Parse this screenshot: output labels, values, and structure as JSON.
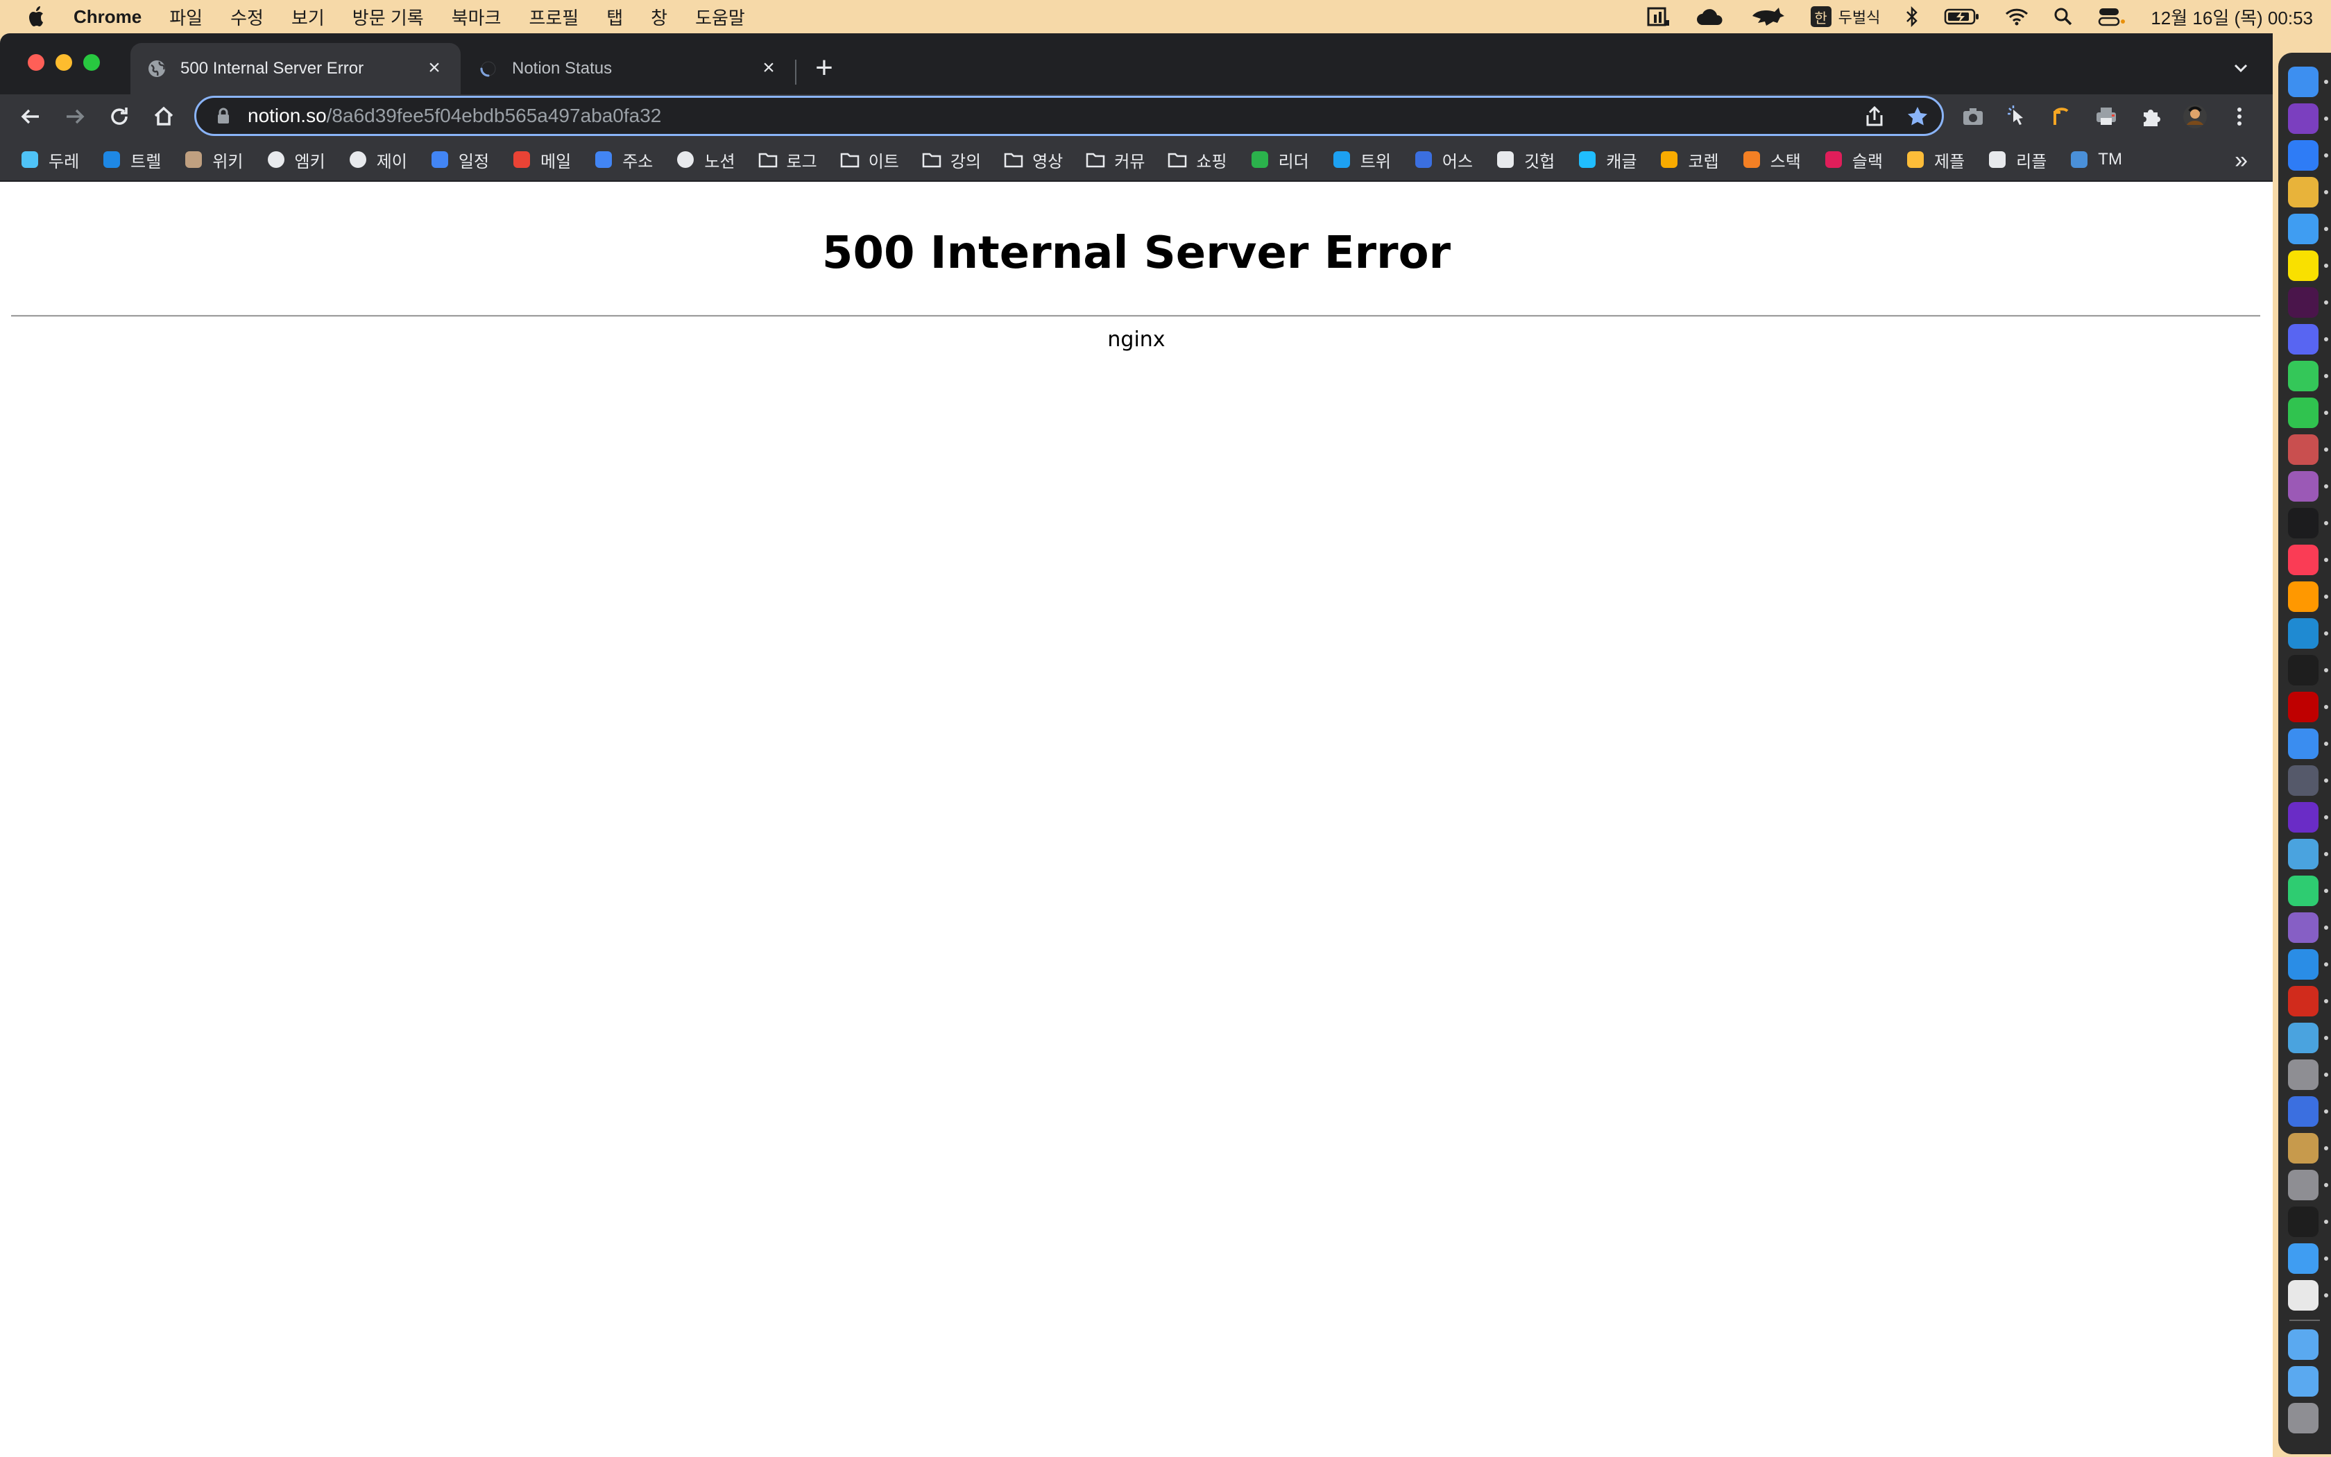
{
  "menubar": {
    "app_name": "Chrome",
    "items": [
      "파일",
      "수정",
      "보기",
      "방문 기록",
      "북마크",
      "프로필",
      "탭",
      "창",
      "도움말"
    ],
    "ime_label": "두벌식",
    "ime_char": "한",
    "clock": "12월 16일 (목) 00:53"
  },
  "tabs": [
    {
      "title": "500 Internal Server Error",
      "icon": "globe-icon",
      "active": true
    },
    {
      "title": "Notion Status",
      "icon": "loading-spinner-icon",
      "active": false
    }
  ],
  "omnibox": {
    "host": "notion.so",
    "path": "/8a6d39fee5f04ebdb565a497aba0fa32"
  },
  "bookmarks": [
    {
      "label": "두레",
      "icon": "mail-icon",
      "color": "#4fc3f7"
    },
    {
      "label": "트렐",
      "icon": "trello-icon",
      "color": "#1e88e5"
    },
    {
      "label": "위키",
      "icon": "wiki-icon",
      "color": "#c0a080"
    },
    {
      "label": "엠키",
      "icon": "globe-icon",
      "color": "#e8eaed"
    },
    {
      "label": "제이",
      "icon": "globe-icon",
      "color": "#e8eaed"
    },
    {
      "label": "일정",
      "icon": "calendar-icon",
      "color": "#4285f4"
    },
    {
      "label": "메일",
      "icon": "gmail-icon",
      "color": "#ea4335"
    },
    {
      "label": "주소",
      "icon": "contacts-icon",
      "color": "#4285f4"
    },
    {
      "label": "노션",
      "icon": "globe-icon",
      "color": "#e8eaed"
    },
    {
      "label": "로그",
      "icon": "folder-icon",
      "color": "#e8eaed"
    },
    {
      "label": "이트",
      "icon": "folder-icon",
      "color": "#e8eaed"
    },
    {
      "label": "강의",
      "icon": "folder-icon",
      "color": "#e8eaed"
    },
    {
      "label": "영상",
      "icon": "folder-icon",
      "color": "#e8eaed"
    },
    {
      "label": "커뮤",
      "icon": "folder-icon",
      "color": "#e8eaed"
    },
    {
      "label": "쇼핑",
      "icon": "folder-icon",
      "color": "#e8eaed"
    },
    {
      "label": "리더",
      "icon": "feedly-icon",
      "color": "#2bb24c"
    },
    {
      "label": "트위",
      "icon": "twitter-icon",
      "color": "#1da1f2"
    },
    {
      "label": "어스",
      "icon": "earth-icon",
      "color": "#3b6fe0"
    },
    {
      "label": "깃헙",
      "icon": "github-icon",
      "color": "#e8eaed"
    },
    {
      "label": "캐글",
      "icon": "kaggle-icon",
      "color": "#20beff"
    },
    {
      "label": "코렙",
      "icon": "colab-icon",
      "color": "#f9ab00"
    },
    {
      "label": "스택",
      "icon": "stackoverflow-icon",
      "color": "#f48024"
    },
    {
      "label": "슬랙",
      "icon": "slack-icon",
      "color": "#e01e5a"
    },
    {
      "label": "제플",
      "icon": "zeplin-icon",
      "color": "#fdbd39"
    },
    {
      "label": "리플",
      "icon": "replit-icon",
      "color": "#e8eaed"
    },
    {
      "label": "TM",
      "icon": "tm-icon",
      "color": "#4a90d9"
    }
  ],
  "page": {
    "title": "500 Internal Server Error",
    "footer": "nginx"
  },
  "dock_apps": [
    {
      "name": "finder-icon",
      "color": "#3d8ff0"
    },
    {
      "name": "onenote-icon",
      "color": "#7b3fbf"
    },
    {
      "name": "things-icon",
      "color": "#2e7cf6"
    },
    {
      "name": "chrome-icon",
      "color": "#e8b33a"
    },
    {
      "name": "safari-icon",
      "color": "#3f9df2"
    },
    {
      "name": "kakaotalk-icon",
      "color": "#f9e000"
    },
    {
      "name": "slack-icon",
      "color": "#4a154b"
    },
    {
      "name": "discord-icon",
      "color": "#5865f2"
    },
    {
      "name": "messages-icon",
      "color": "#34c759"
    },
    {
      "name": "facetime-icon",
      "color": "#30c34f"
    },
    {
      "name": "davinci-icon",
      "color": "#c94f4f"
    },
    {
      "name": "photos-icon",
      "color": "#9b59b6"
    },
    {
      "name": "appletv-icon",
      "color": "#1c1c1e"
    },
    {
      "name": "music-icon",
      "color": "#fa3c55"
    },
    {
      "name": "sublime-icon",
      "color": "#ff9800"
    },
    {
      "name": "vscode-icon",
      "color": "#1f8ad2"
    },
    {
      "name": "terminal-icon",
      "color": "#1e1e1e"
    },
    {
      "name": "filezilla-icon",
      "color": "#bf0000"
    },
    {
      "name": "mail-icon",
      "color": "#3a8df0"
    },
    {
      "name": "sequel-icon",
      "color": "#55596a"
    },
    {
      "name": "intellij-icon",
      "color": "#6a2cc6"
    },
    {
      "name": "dbeaver-icon",
      "color": "#4aa3df"
    },
    {
      "name": "activity-icon",
      "color": "#2ecc71"
    },
    {
      "name": "visualstudio-icon",
      "color": "#865fc5"
    },
    {
      "name": "xcode-icon",
      "color": "#2a8de6"
    },
    {
      "name": "acrobat-icon",
      "color": "#d12b1c"
    },
    {
      "name": "utility-icon",
      "color": "#4aa3df"
    },
    {
      "name": "calculator-icon",
      "color": "#8e8e93"
    },
    {
      "name": "network-icon",
      "color": "#3b6fe0"
    },
    {
      "name": "archive-icon",
      "color": "#c79a4c"
    },
    {
      "name": "settings-icon",
      "color": "#8e8e93"
    },
    {
      "name": "monitor-icon",
      "color": "#1e1e1e"
    },
    {
      "name": "screen-icon",
      "color": "#3f9df2"
    },
    {
      "name": "maps-icon",
      "color": "#e8e8e8"
    },
    {
      "name": "folder-apps-icon",
      "color": "#5aa9f0"
    },
    {
      "name": "folder-downloads-icon",
      "color": "#5aa9f0"
    },
    {
      "name": "trash-icon",
      "color": "#8e8e93"
    }
  ]
}
